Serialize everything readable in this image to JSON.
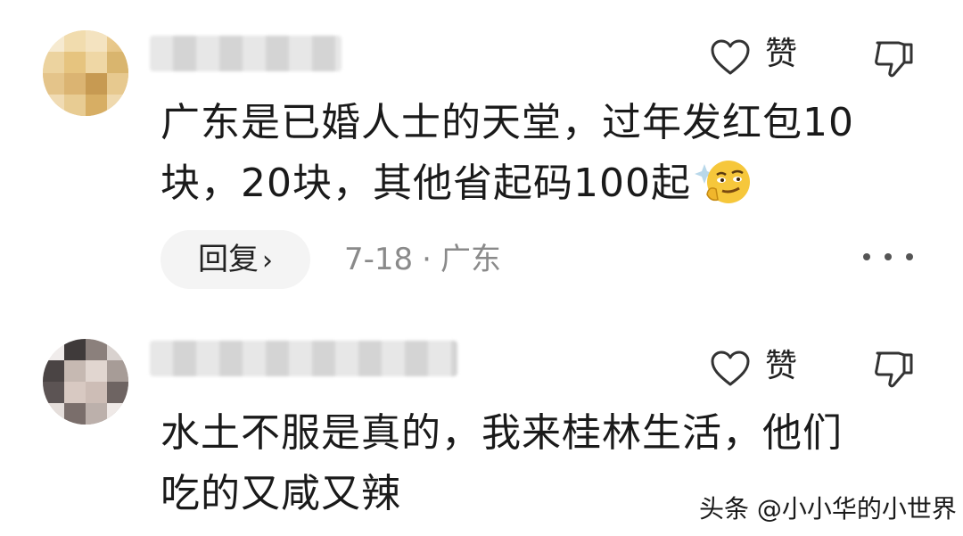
{
  "comments": [
    {
      "like_label": "赞",
      "text_line1": "广东是已婚人士的天堂，过年发红包10",
      "text_line2": "块，20块，其他省起码100起",
      "emoji_icon": "smirk-face-emoji",
      "reply_label": "回复",
      "date": "7-18",
      "location": "广东"
    },
    {
      "like_label": "赞",
      "text_line1": "水土不服是真的，我来桂林生活，他们",
      "text_line2": "吃的又咸又辣"
    }
  ],
  "meta_separator": "·",
  "watermark": "头条 @小小华的小世界",
  "colors": {
    "text": "#1a1a1a",
    "meta": "#8a8a8a",
    "reply_bg": "#f4f4f4"
  }
}
